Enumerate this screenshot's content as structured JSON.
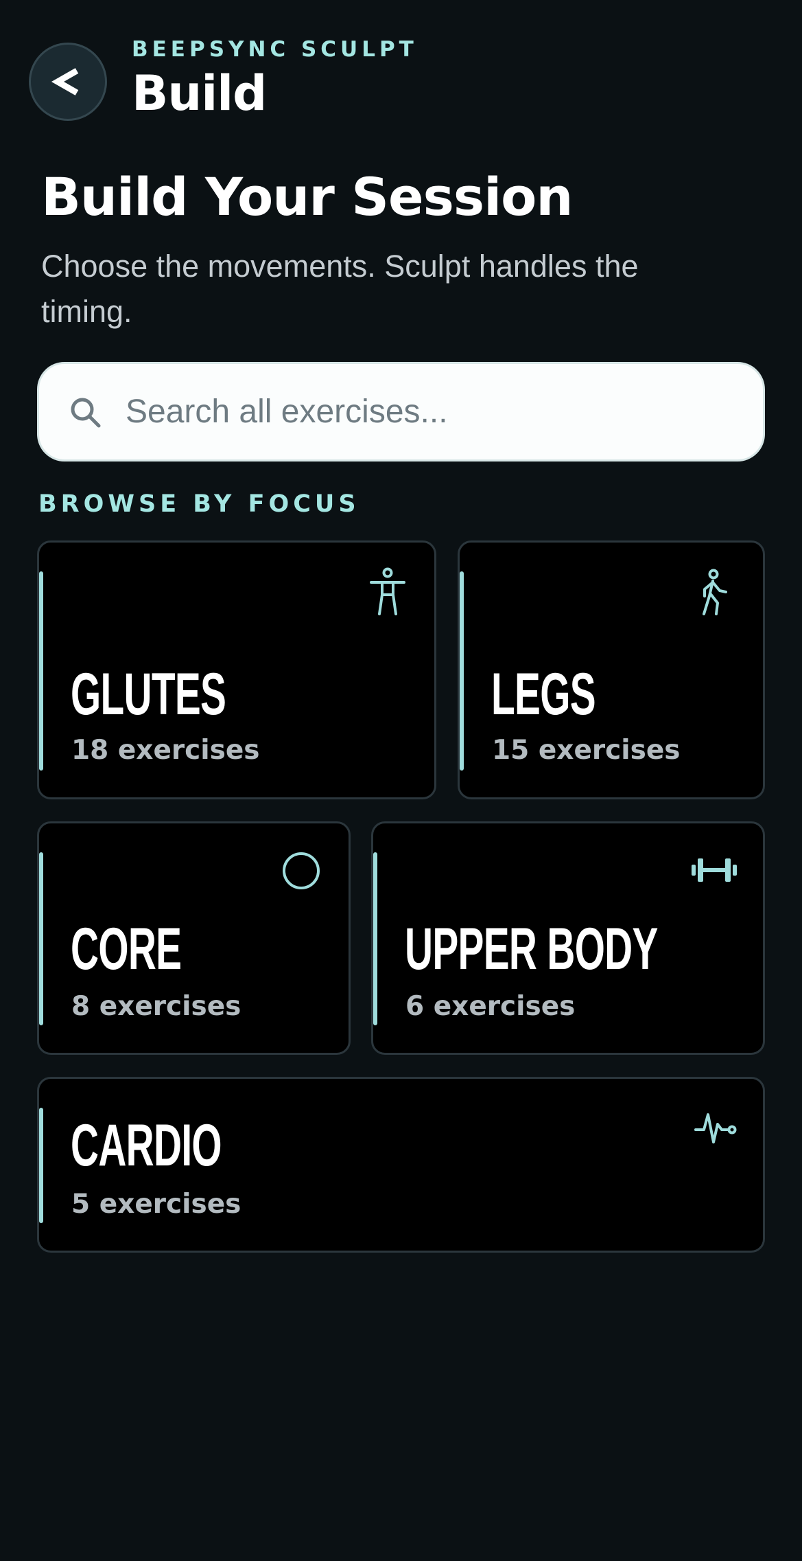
{
  "header": {
    "app_name": "BEEPSYNC SCULPT",
    "screen_title": "Build",
    "back_label": "<"
  },
  "hero": {
    "title": "Build Your Session",
    "subtitle": "Choose the movements. Sculpt handles the timing."
  },
  "search": {
    "placeholder": "Search all exercises..."
  },
  "browse": {
    "label": "BROWSE BY FOCUS",
    "categories": [
      {
        "title": "GLUTES",
        "count": "18 exercises",
        "icon": "person-icon"
      },
      {
        "title": "LEGS",
        "count": "15 exercises",
        "icon": "walking-icon"
      },
      {
        "title": "CORE",
        "count": "8 exercises",
        "icon": "circle-icon"
      },
      {
        "title": "UPPER BODY",
        "count": "6 exercises",
        "icon": "dumbbell-icon"
      },
      {
        "title": "CARDIO",
        "count": "5 exercises",
        "icon": "heart-pulse-icon"
      }
    ]
  },
  "colors": {
    "background": "#0b1114",
    "accent": "#a4e6e2",
    "card_background": "#000000",
    "card_border": "#2b363c",
    "search_background": "#fbfdfd"
  }
}
